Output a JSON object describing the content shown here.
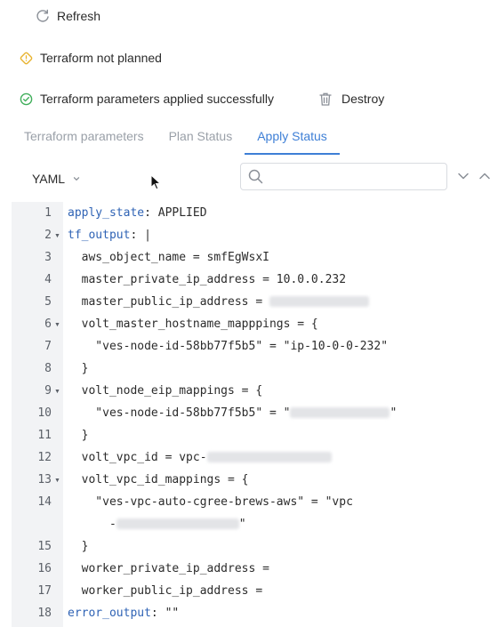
{
  "toolbar": {
    "refresh_label": "Refresh",
    "destroy_label": "Destroy"
  },
  "status": {
    "plan": "Terraform not planned",
    "apply": "Terraform parameters applied successfully"
  },
  "tabs": [
    {
      "label": "Terraform parameters",
      "active": false
    },
    {
      "label": "Plan Status",
      "active": false
    },
    {
      "label": "Apply Status",
      "active": true
    }
  ],
  "format": {
    "selected": "YAML"
  },
  "search": {
    "placeholder": "",
    "value": ""
  },
  "editor": {
    "lines": [
      {
        "num": "1",
        "key": "apply_state",
        "rest": ": APPLIED"
      },
      {
        "num": "2",
        "key": "tf_output",
        "rest": ": |",
        "foldable": true
      },
      {
        "num": "3",
        "text": "  aws_object_name = smfEgWsxI"
      },
      {
        "num": "4",
        "text": "  master_private_ip_address = 10.0.0.232"
      },
      {
        "num": "5",
        "text": "  master_public_ip_address = ",
        "redacted": true
      },
      {
        "num": "6",
        "text": "  volt_master_hostname_mapppings = {",
        "foldable": true
      },
      {
        "num": "7",
        "text": "    \"ves-node-id-58bb77f5b5\" = \"ip-10-0-0-232\""
      },
      {
        "num": "8",
        "text": "  }"
      },
      {
        "num": "9",
        "text": "  volt_node_eip_mappings = {",
        "foldable": true
      },
      {
        "num": "10",
        "text": "    \"ves-node-id-58bb77f5b5\" = \"",
        "redacted": true,
        "after": "\""
      },
      {
        "num": "11",
        "text": "  }"
      },
      {
        "num": "12",
        "text": "  volt_vpc_id = vpc-",
        "redacted": true
      },
      {
        "num": "13",
        "text": "  volt_vpc_id_mappings = {",
        "foldable": true
      },
      {
        "num": "14",
        "text": "    \"ves-vpc-auto-cgree-brews-aws\" = \"vpc",
        "wrapped": "      -",
        "redacted": true,
        "after": "\""
      },
      {
        "num": "15",
        "text": "  }"
      },
      {
        "num": "16",
        "text": "  worker_private_ip_address ="
      },
      {
        "num": "17",
        "text": "  worker_public_ip_address ="
      },
      {
        "num": "18",
        "key": "error_output",
        "rest": ": \"\""
      }
    ]
  }
}
